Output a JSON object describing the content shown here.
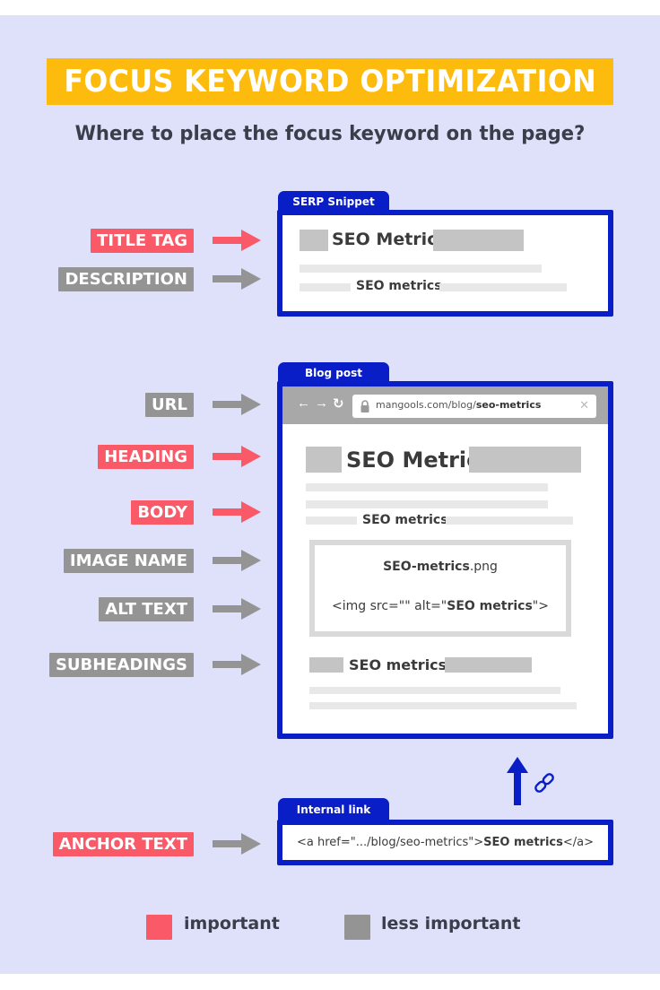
{
  "title": "FOCUS KEYWORD OPTIMIZATION",
  "subtitle": "Where to place the focus keyword on the page?",
  "colors": {
    "background": "#dfe1fa",
    "title_bar": "#fdbb0e",
    "important": "#fa5968",
    "less_important": "#949494",
    "panel_border": "#0a1ec8"
  },
  "labels": {
    "title_tag": "TITLE TAG",
    "description": "DESCRIPTION",
    "url": "URL",
    "heading": "HEADING",
    "body": "BODY",
    "image_name": "IMAGE NAME",
    "alt_text": "ALT TEXT",
    "subheadings": "SUBHEADINGS",
    "anchor_text": "ANCHOR TEXT"
  },
  "label_importance": {
    "title_tag": "important",
    "description": "less important",
    "url": "less important",
    "heading": "important",
    "body": "important",
    "image_name": "less important",
    "alt_text": "less important",
    "subheadings": "less important",
    "anchor_text": "important"
  },
  "serp": {
    "tab": "SERP Snippet",
    "title": "SEO Metrics",
    "description_keyword": "SEO metrics"
  },
  "blog": {
    "tab": "Blog post",
    "url_prefix": "mangools.com/blog/",
    "url_slug": "seo-metrics",
    "heading": "SEO Metrics",
    "body_keyword": "SEO metrics",
    "image_name_bold": "SEO-metrics",
    "image_name_ext": ".png",
    "alt_prefix": "<img src=\"\" alt=\"",
    "alt_keyword": "SEO metrics",
    "alt_suffix": "\">",
    "subheading": "SEO metrics"
  },
  "internal_link": {
    "tab": "Internal link",
    "code_prefix": "<a href=\".../blog/seo-metrics\">",
    "anchor": "SEO metrics",
    "code_suffix": "</a>"
  },
  "icons": {
    "back": "←",
    "forward": "→",
    "reload": "↻",
    "close": "✕"
  },
  "legend": {
    "important": "important",
    "less_important": "less important"
  }
}
